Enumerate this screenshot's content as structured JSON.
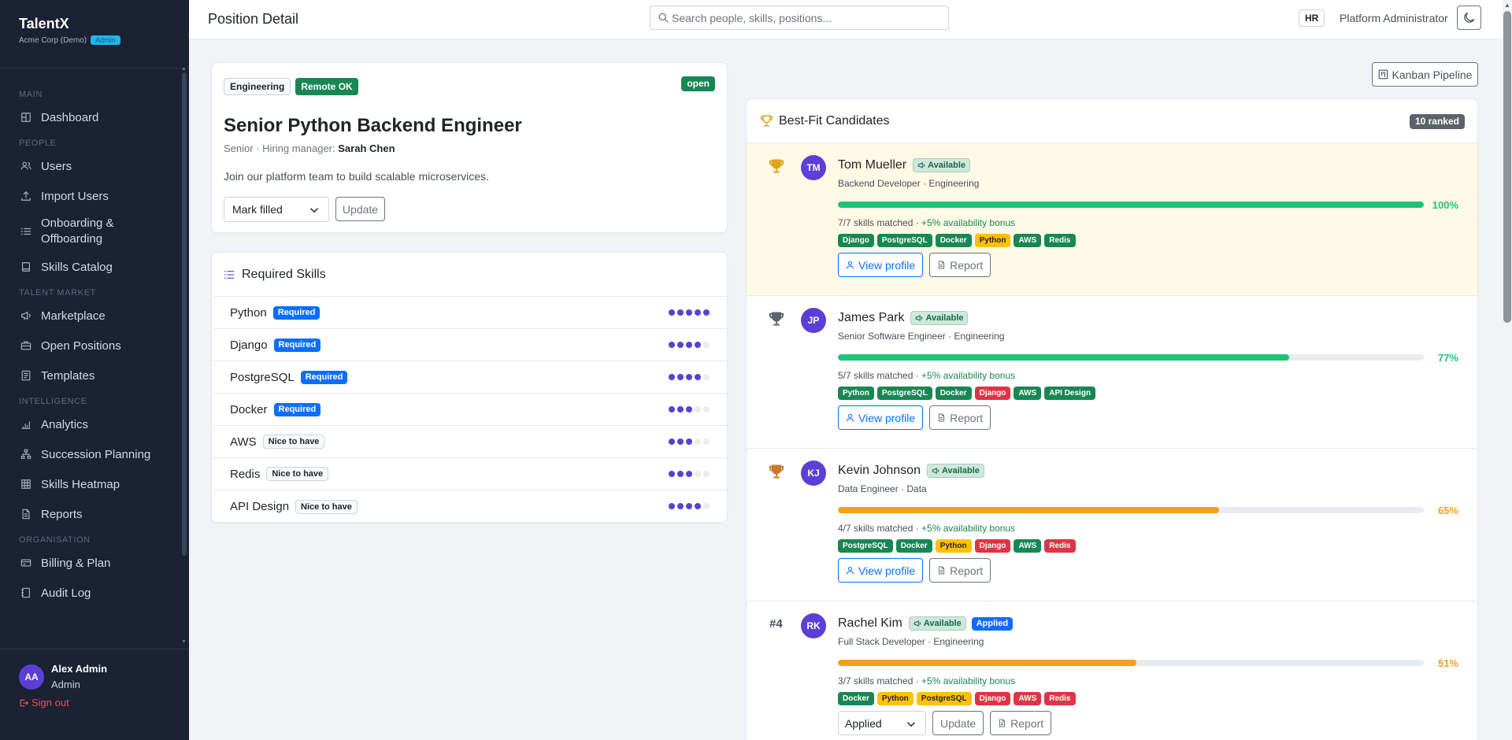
{
  "app": {
    "name": "TalentX",
    "org": "Acme Corp (Demo)",
    "org_badge": "Admin",
    "page_title": "Position Detail"
  },
  "sidebar": {
    "sections": [
      {
        "title": "MAIN",
        "items": [
          {
            "label": "Dashboard",
            "icon": "dashboard-icon"
          }
        ]
      },
      {
        "title": "PEOPLE",
        "items": [
          {
            "label": "Users",
            "icon": "users-icon"
          },
          {
            "label": "Import Users",
            "icon": "upload-icon"
          },
          {
            "label": "Onboarding & Offboarding",
            "icon": "list-icon"
          },
          {
            "label": "Skills Catalog",
            "icon": "book-icon"
          }
        ]
      },
      {
        "title": "TALENT MARKET",
        "items": [
          {
            "label": "Marketplace",
            "icon": "megaphone-icon"
          },
          {
            "label": "Open Positions",
            "icon": "briefcase-icon"
          },
          {
            "label": "Templates",
            "icon": "template-icon"
          }
        ]
      },
      {
        "title": "INTELLIGENCE",
        "items": [
          {
            "label": "Analytics",
            "icon": "chart-icon"
          },
          {
            "label": "Succession Planning",
            "icon": "hierarchy-icon"
          },
          {
            "label": "Skills Heatmap",
            "icon": "grid-icon"
          },
          {
            "label": "Reports",
            "icon": "document-icon"
          }
        ]
      },
      {
        "title": "ORGANISATION",
        "items": [
          {
            "label": "Billing & Plan",
            "icon": "credit-card-icon"
          },
          {
            "label": "Audit Log",
            "icon": "journal-icon"
          }
        ]
      }
    ],
    "user": {
      "initials": "AA",
      "name": "Alex Admin",
      "role": "Admin",
      "signout": "Sign out"
    }
  },
  "topbar": {
    "search_placeholder": "Search people, skills, positions...",
    "role_badge": "HR",
    "user_label": "Platform Administrator"
  },
  "position": {
    "department": "Engineering",
    "remote": "Remote OK",
    "status": "open",
    "title": "Senior Python Backend Engineer",
    "level": "Senior",
    "manager_label": "Hiring manager:",
    "manager": "Sarah Chen",
    "description": "Join our platform team to build scalable microservices.",
    "status_select": "Mark filled",
    "update_label": "Update"
  },
  "required_skills": {
    "title": "Required Skills",
    "items": [
      {
        "name": "Python",
        "badge": "Required",
        "required": true,
        "level": 5
      },
      {
        "name": "Django",
        "badge": "Required",
        "required": true,
        "level": 4
      },
      {
        "name": "PostgreSQL",
        "badge": "Required",
        "required": true,
        "level": 4
      },
      {
        "name": "Docker",
        "badge": "Required",
        "required": true,
        "level": 3
      },
      {
        "name": "AWS",
        "badge": "Nice to have",
        "required": false,
        "level": 3
      },
      {
        "name": "Redis",
        "badge": "Nice to have",
        "required": false,
        "level": 3
      },
      {
        "name": "API Design",
        "badge": "Nice to have",
        "required": false,
        "level": 4
      }
    ]
  },
  "kanban_label": "Kanban Pipeline",
  "candidates": {
    "title": "Best-Fit Candidates",
    "ranked": "10 ranked",
    "view_profile": "View profile",
    "report": "Report",
    "update": "Update",
    "items": [
      {
        "rank": "1",
        "initials": "TM",
        "name": "Tom Mueller",
        "availability": "Available",
        "applied": "",
        "role": "Backend Developer · Engineering",
        "match": 100,
        "pct": "100%",
        "color": "#20c27a",
        "matched": "7/7 skills matched · ",
        "bonus": "+5% availability bonus",
        "skills": [
          {
            "name": "Django",
            "c": "g"
          },
          {
            "name": "PostgreSQL",
            "c": "g"
          },
          {
            "name": "Docker",
            "c": "g"
          },
          {
            "name": "Python",
            "c": "y"
          },
          {
            "name": "AWS",
            "c": "g"
          },
          {
            "name": "Redis",
            "c": "g"
          }
        ]
      },
      {
        "rank": "2",
        "initials": "JP",
        "name": "James Park",
        "availability": "Available",
        "applied": "",
        "role": "Senior Software Engineer · Engineering",
        "match": 77,
        "pct": "77%",
        "color": "#20c27a",
        "matched": "5/7 skills matched · ",
        "bonus": "+5% availability bonus",
        "skills": [
          {
            "name": "Python",
            "c": "g"
          },
          {
            "name": "PostgreSQL",
            "c": "g"
          },
          {
            "name": "Docker",
            "c": "g"
          },
          {
            "name": "Django",
            "c": "r"
          },
          {
            "name": "AWS",
            "c": "g"
          },
          {
            "name": "API Design",
            "c": "g"
          }
        ]
      },
      {
        "rank": "3",
        "initials": "KJ",
        "name": "Kevin Johnson",
        "availability": "Available",
        "applied": "",
        "role": "Data Engineer · Data",
        "match": 65,
        "pct": "65%",
        "color": "#f5a01a",
        "matched": "4/7 skills matched · ",
        "bonus": "+5% availability bonus",
        "skills": [
          {
            "name": "PostgreSQL",
            "c": "g"
          },
          {
            "name": "Docker",
            "c": "g"
          },
          {
            "name": "Python",
            "c": "y"
          },
          {
            "name": "Django",
            "c": "r"
          },
          {
            "name": "AWS",
            "c": "g"
          },
          {
            "name": "Redis",
            "c": "r"
          }
        ]
      },
      {
        "rank": "#4",
        "initials": "RK",
        "name": "Rachel Kim",
        "availability": "Available",
        "applied": "Applied",
        "role": "Full Stack Developer · Engineering",
        "match": 51,
        "pct": "51%",
        "color": "#f5a01a",
        "matched": "3/7 skills matched · ",
        "bonus": "+5% availability bonus",
        "stage": "Applied",
        "skills": [
          {
            "name": "Docker",
            "c": "g"
          },
          {
            "name": "Python",
            "c": "y"
          },
          {
            "name": "PostgreSQL",
            "c": "y"
          },
          {
            "name": "Django",
            "c": "r"
          },
          {
            "name": "AWS",
            "c": "r"
          },
          {
            "name": "Redis",
            "c": "r"
          }
        ]
      }
    ]
  },
  "colors": {
    "sidebar": "#1a2233",
    "accent": "#5b3fd6",
    "primary": "#0d6efd",
    "success": "#198754"
  }
}
